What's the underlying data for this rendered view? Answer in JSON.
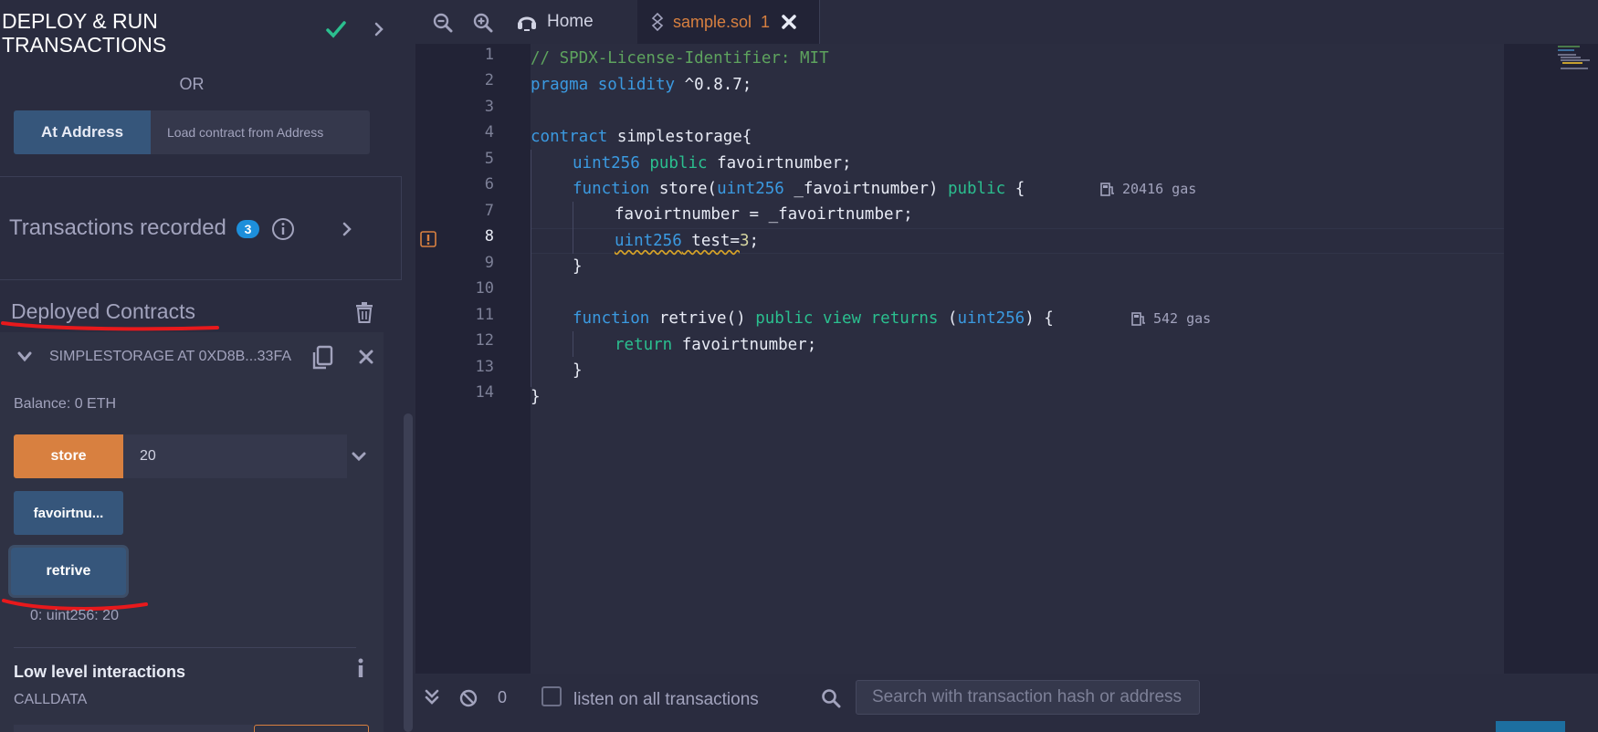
{
  "left_panel": {
    "title": "DEPLOY & RUN TRANSACTIONS",
    "or_label": "OR",
    "at_address_button": "At Address",
    "load_contract_placeholder": "Load contract from Address",
    "transactions_recorded_label": "Transactions recorded",
    "transactions_recorded_count": "3",
    "deployed_contracts_title": "Deployed Contracts",
    "instance": {
      "name": "SIMPLESTORAGE AT 0XD8B...33FA",
      "balance": "Balance: 0 ETH",
      "functions": {
        "store_label": "store",
        "store_value": "20",
        "favoirt_label": "favoirtnu...",
        "retrive_label": "retrive"
      },
      "retrive_output": "0: uint256: 20"
    },
    "low_level_title": "Low level interactions",
    "calldata_label": "CALLDATA"
  },
  "editor": {
    "tabs": {
      "home_label": "Home",
      "file_name": "sample.sol",
      "file_error_count": "1"
    },
    "line_numbers": [
      "1",
      "2",
      "3",
      "4",
      "5",
      "6",
      "7",
      "8",
      "9",
      "10",
      "11",
      "12",
      "13",
      "14"
    ],
    "active_line": 8,
    "code": {
      "l1": "// SPDX-License-Identifier: MIT",
      "l2_kw": "pragma solidity",
      "l2_rest": " ^0.8.7;",
      "l4_kw": "contract",
      "l4_rest": " simplestorage{",
      "l5_type": "uint256",
      "l5_mod": "public",
      "l5_rest": " favoirtnumber;",
      "l6_fn": "function",
      "l6_a": " store(",
      "l6_type": "uint256",
      "l6_b": " _favoirtnumber) ",
      "l6_mod": "public",
      "l6_c": " {",
      "l7": "favoirtnumber = _favoirtnumber;",
      "l8_type": "uint256",
      "l8_rest": " test=",
      "l8_num": "3",
      "l8_end": ";",
      "l9": "}",
      "l11_fn": "function",
      "l11_a": " retrive() ",
      "l11_mod": "public view returns",
      "l11_b": " (",
      "l11_type": "uint256",
      "l11_c": ") {",
      "l12_kw": "return",
      "l12_rest": " favoirtnumber;",
      "l13": "}",
      "l14": "}"
    },
    "gas": {
      "store": "20416 gas",
      "retrive": "542 gas"
    }
  },
  "terminal": {
    "count": "0",
    "listen_label": "listen on all transactions",
    "search_placeholder": "Search with transaction hash or address"
  },
  "colors": {
    "accent_orange": "#d88040",
    "button_blue": "#36567b",
    "badge_blue": "#1d8fdb",
    "annotation_red": "#e8191c",
    "success_green": "#2bbf8f"
  }
}
